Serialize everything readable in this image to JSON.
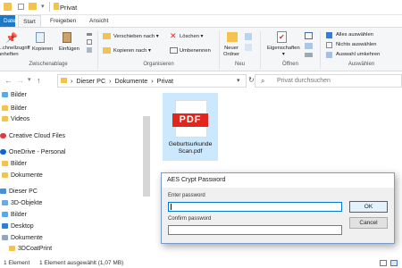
{
  "window": {
    "title": "Privat"
  },
  "tabs": [
    "Datei",
    "Start",
    "Freigeben",
    "Ansicht"
  ],
  "ribbon": {
    "clipboard": {
      "pin_label": "...chnellzugriff\nanheften",
      "copy_label": "Kopieren",
      "paste_label": "Einfügen",
      "group_label": "Zwischenablage"
    },
    "organize": {
      "move_to": "Verschieben nach ▾",
      "copy_to": "Kopieren nach ▾",
      "delete": "Löschen ▾",
      "rename": "Umbenennen",
      "group_label": "Organisieren"
    },
    "new": {
      "new_folder": "Neuer\nOrdner",
      "group_label": "Neu"
    },
    "open": {
      "properties": "Eigenschaften\n▾",
      "group_label": "Öffnen"
    },
    "select": {
      "select_all": "Alles auswählen",
      "select_none": "Nichts auswählen",
      "invert": "Auswahl umkehren",
      "group_label": "Auswählen"
    }
  },
  "address": {
    "path": "›  Dieser PC  ›  Dokumente  ›  Privat",
    "search_placeholder": "Privat durchsuchen"
  },
  "nav": {
    "items": [
      "Bilder",
      "Bilder",
      "Videos",
      "Creative Cloud Files",
      "OneDrive - Personal",
      "Bilder",
      "Dokumente",
      "Dieser PC",
      "3D-Objekte",
      "Bilder",
      "Desktop",
      "Dokumente",
      "3DCoatPrint"
    ]
  },
  "file": {
    "name": "Geburtsurkunde\nScan.pdf",
    "badge": "PDF"
  },
  "status": {
    "count": "1 Element",
    "selected": "1 Element ausgewählt (1,07 MB)"
  },
  "dialog": {
    "title": "AES Crypt Password",
    "enter_label": "Enter password",
    "confirm_label": "Confirm password",
    "ok": "OK",
    "cancel": "Cancel"
  },
  "colors": {
    "accent": "#1979ca",
    "pdf": "#e2261d",
    "folder": "#f3c24f",
    "onedrive": "#0a64d6",
    "cc": "#e03a3e"
  }
}
